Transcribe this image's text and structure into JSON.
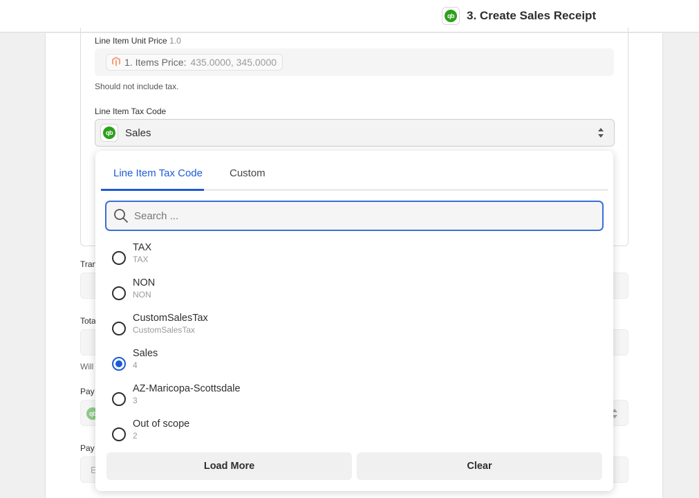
{
  "header": {
    "step_title": "3. Create Sales Receipt",
    "app_icon": "quickbooks-logo"
  },
  "unit_price": {
    "label": "Line Item Unit Price",
    "version": "1.0",
    "pill_prefix": "1. Items Price:",
    "pill_value": "435.0000, 345.0000",
    "pill_icon": "magento-logo",
    "help": "Should not include tax."
  },
  "tax_code": {
    "label": "Line Item Tax Code",
    "selected": "Sales",
    "icon": "quickbooks-logo"
  },
  "background_labels": {
    "tran": "Tran",
    "tota": "Tota",
    "will": "Will",
    "pay1": "Pay",
    "pay2": "Pay",
    "e": "E"
  },
  "dropdown": {
    "tabs": [
      "Line Item Tax Code",
      "Custom"
    ],
    "active_tab": 0,
    "search_placeholder": "Search ...",
    "options": [
      {
        "label": "TAX",
        "sub": "TAX",
        "checked": false
      },
      {
        "label": "NON",
        "sub": "NON",
        "checked": false
      },
      {
        "label": "CustomSalesTax",
        "sub": "CustomSalesTax",
        "checked": false
      },
      {
        "label": "Sales",
        "sub": "4",
        "checked": true
      },
      {
        "label": "AZ-Maricopa-Scottsdale",
        "sub": "3",
        "checked": false
      },
      {
        "label": "Out of scope",
        "sub": "2",
        "checked": false
      }
    ],
    "load_more": "Load More",
    "clear": "Clear"
  },
  "colors": {
    "accent": "#1d5bd6",
    "quickbooks_green": "#2ca01c",
    "magento_orange": "#f26322"
  }
}
